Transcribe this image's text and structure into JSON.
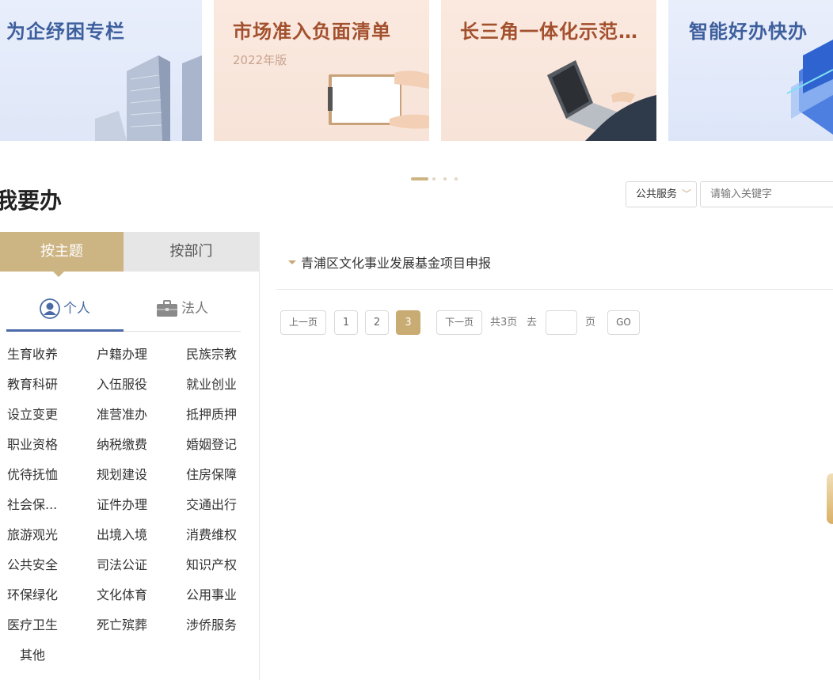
{
  "banners": [
    {
      "title": "为企纾困专栏",
      "subtitle": ""
    },
    {
      "title": "市场准入负面清单",
      "subtitle": "2022年版"
    },
    {
      "title": "长三角一体化示范区...",
      "subtitle": ""
    },
    {
      "title": "智能好办快办",
      "subtitle": ""
    }
  ],
  "section_title": "我要办",
  "search": {
    "select_value": "公共服务",
    "placeholder": "请输入关键字"
  },
  "tabs": {
    "topic": "按主题",
    "department": "按部门"
  },
  "subtabs": {
    "personal": "个人",
    "legal": "法人"
  },
  "categories": [
    "生育收养",
    "户籍办理",
    "民族宗教",
    "教育科研",
    "入伍服役",
    "就业创业",
    "设立变更",
    "准营准办",
    "抵押质押",
    "职业资格",
    "纳税缴费",
    "婚姻登记",
    "优待抚恤",
    "规划建设",
    "住房保障",
    "社会保...",
    "证件办理",
    "交通出行",
    "旅游观光",
    "出境入境",
    "消费维权",
    "公共安全",
    "司法公证",
    "知识产权",
    "环保绿化",
    "文化体育",
    "公用事业",
    "医疗卫生",
    "死亡殡葬",
    "涉侨服务",
    "其他"
  ],
  "items": [
    "青浦区文化事业发展基金项目申报"
  ],
  "pagination": {
    "prev": "上一页",
    "pages": [
      "1",
      "2",
      "3"
    ],
    "current": "3",
    "next": "下一页",
    "total": "共3页",
    "goto_label": "去",
    "page_unit": "页",
    "go": "GO"
  },
  "colors": {
    "accent": "#cdb483",
    "blue": "#4a6aa8",
    "brown_title": "#a3502e"
  }
}
